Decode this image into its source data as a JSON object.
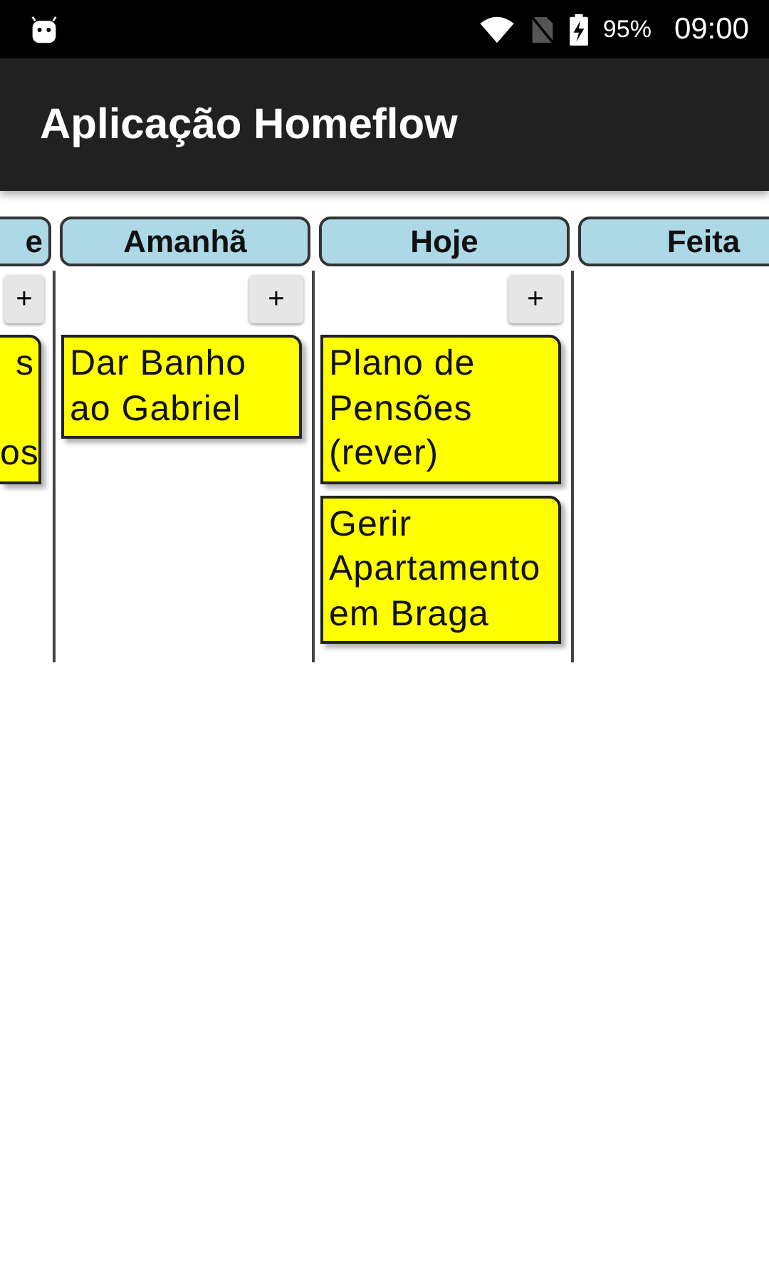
{
  "status_bar": {
    "battery": "95%",
    "time": "09:00"
  },
  "app_bar": {
    "title": "Aplicação Homeflow"
  },
  "columns": [
    {
      "title": "e",
      "kind": "cutleft",
      "add_button": "+",
      "cards": [
        {
          "text": "s\n\nos"
        }
      ]
    },
    {
      "title": "Amanhã",
      "add_button": "+",
      "cards": [
        {
          "text": "Dar Banho ao Gabriel"
        }
      ]
    },
    {
      "title": "Hoje",
      "add_button": "+",
      "cards": [
        {
          "text": "Plano de Pensões (rever)"
        },
        {
          "text": "Gerir Apartamento em Braga"
        }
      ]
    },
    {
      "title": "Feita",
      "kind": "cutright"
    }
  ]
}
